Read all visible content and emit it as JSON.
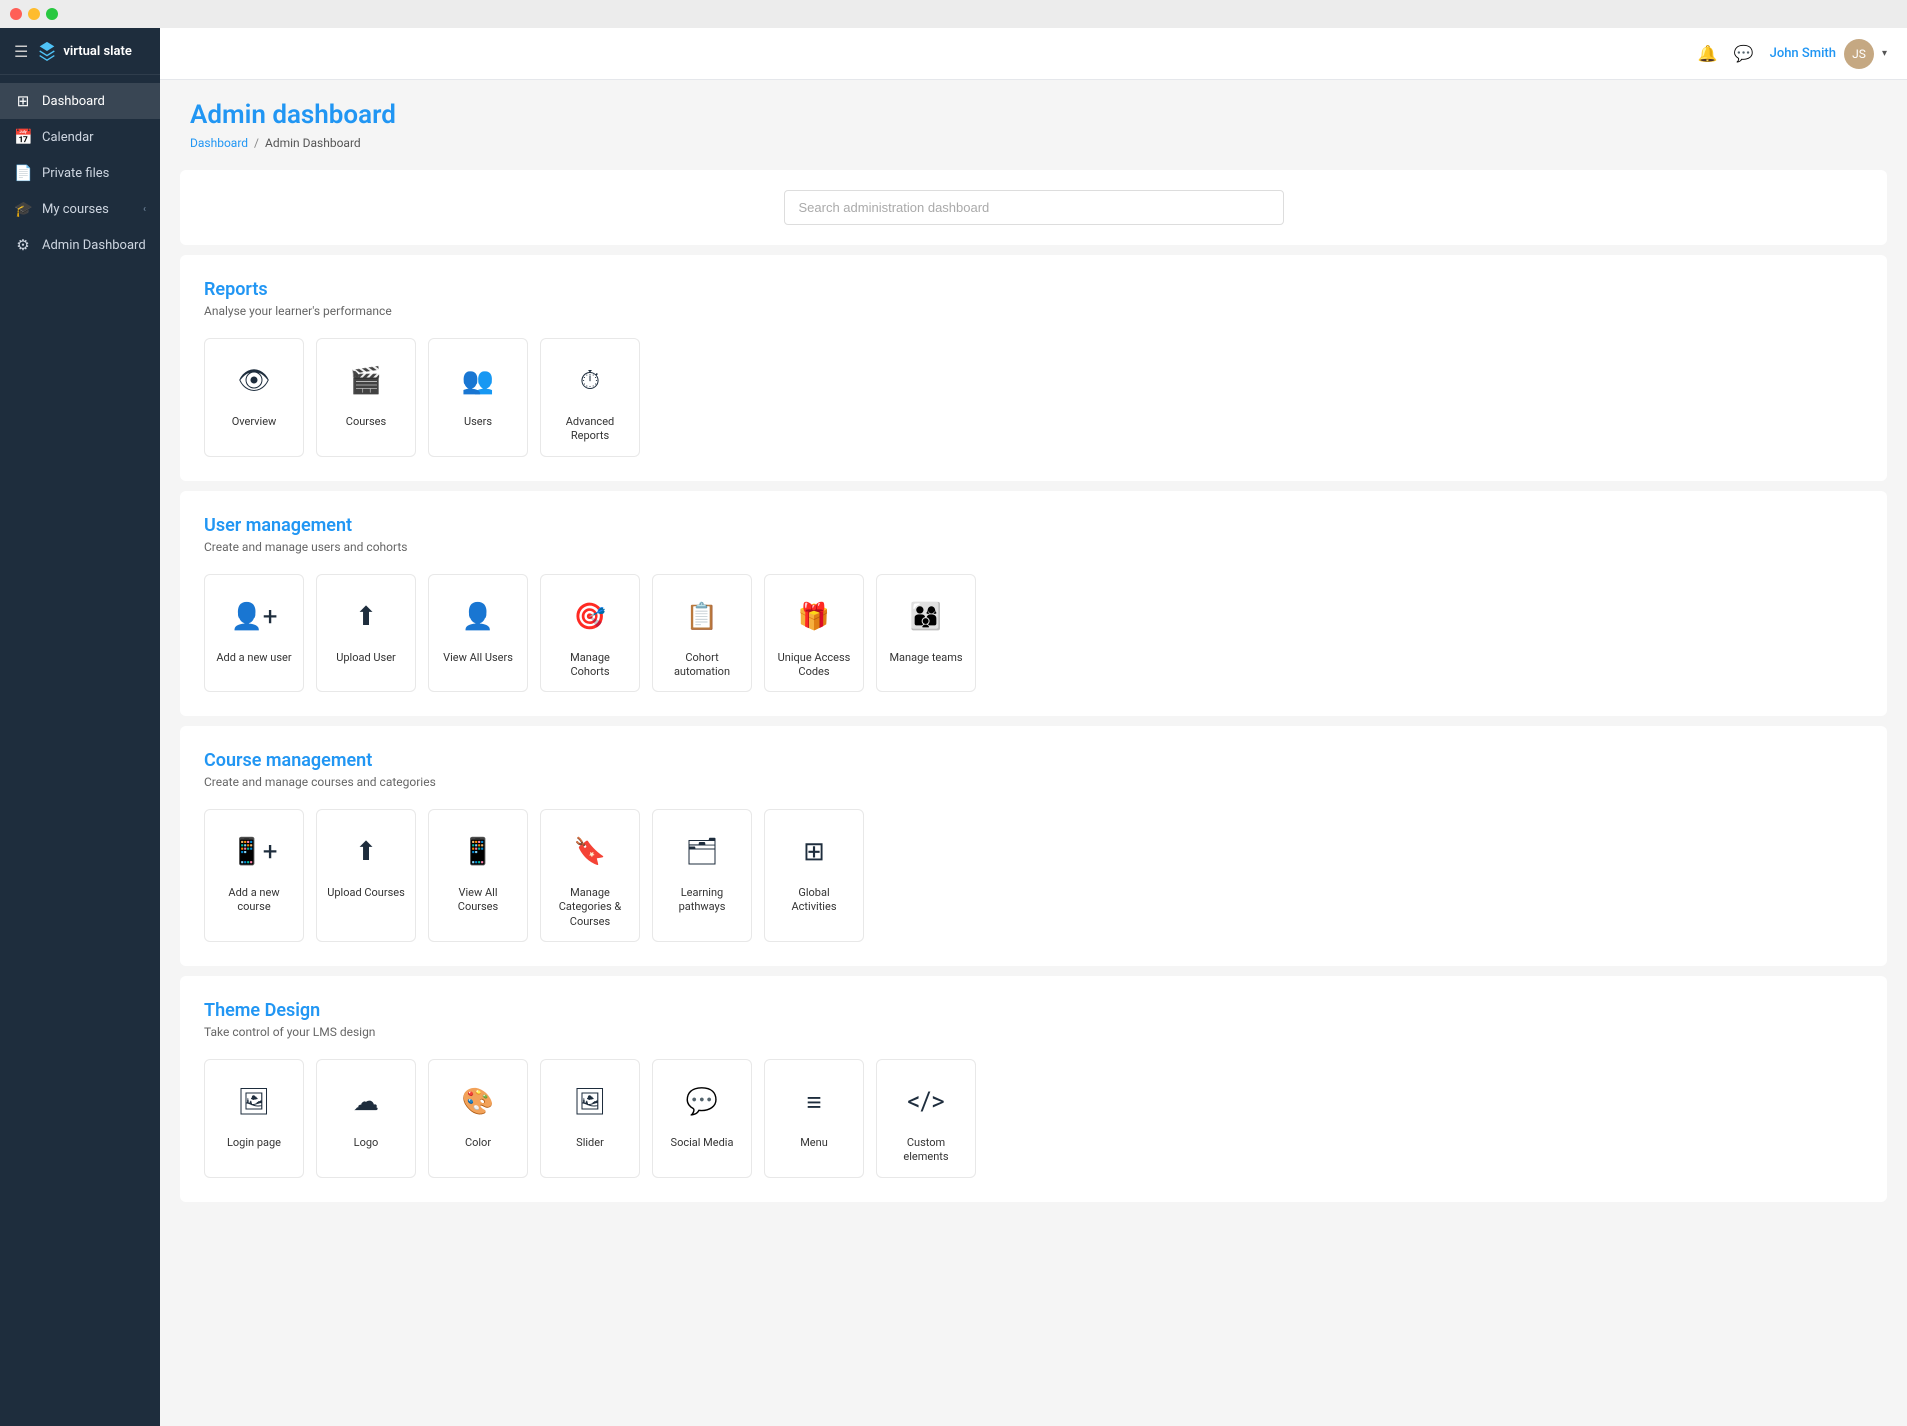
{
  "titlebar": {
    "buttons": [
      "close",
      "minimize",
      "maximize"
    ]
  },
  "brand": {
    "name": "virtual slate",
    "hamburger": "☰"
  },
  "sidebar": {
    "items": [
      {
        "id": "dashboard",
        "label": "Dashboard",
        "icon": "⊞",
        "active": true
      },
      {
        "id": "calendar",
        "label": "Calendar",
        "icon": "📅",
        "active": false
      },
      {
        "id": "private-files",
        "label": "Private files",
        "icon": "📄",
        "active": false
      },
      {
        "id": "my-courses",
        "label": "My courses",
        "icon": "🎓",
        "active": false,
        "hasChevron": true
      },
      {
        "id": "admin-dashboard",
        "label": "Admin Dashboard",
        "icon": "⚙",
        "active": false
      }
    ]
  },
  "topbar": {
    "notification_icon": "🔔",
    "message_icon": "💬",
    "username": "John Smith",
    "chevron": "▾"
  },
  "page": {
    "title": "Admin dashboard",
    "breadcrumb_home": "Dashboard",
    "breadcrumb_sep": "/",
    "breadcrumb_current": "Admin Dashboard"
  },
  "search": {
    "placeholder": "Search administration dashboard"
  },
  "sections": [
    {
      "id": "reports",
      "title": "Reports",
      "description": "Analyse your learner's performance",
      "cards": [
        {
          "id": "overview",
          "label": "Overview",
          "icon": "👁"
        },
        {
          "id": "courses",
          "label": "Courses",
          "icon": "🎬"
        },
        {
          "id": "users",
          "label": "Users",
          "icon": "👥"
        },
        {
          "id": "advanced-reports",
          "label": "Advanced Reports",
          "icon": "⏱"
        }
      ]
    },
    {
      "id": "user-management",
      "title": "User management",
      "description": "Create and manage users and cohorts",
      "cards": [
        {
          "id": "add-new-user",
          "label": "Add a new user",
          "icon": "👤+"
        },
        {
          "id": "upload-user",
          "label": "Upload User",
          "icon": "⬆"
        },
        {
          "id": "view-all-users",
          "label": "View All Users",
          "icon": "👤"
        },
        {
          "id": "manage-cohorts",
          "label": "Manage Cohorts",
          "icon": "🎯"
        },
        {
          "id": "cohort-automation",
          "label": "Cohort automation",
          "icon": "📋"
        },
        {
          "id": "unique-access-codes",
          "label": "Unique Access Codes",
          "icon": "🎁"
        },
        {
          "id": "manage-teams",
          "label": "Manage teams",
          "icon": "👨‍👩‍👦"
        }
      ]
    },
    {
      "id": "course-management",
      "title": "Course management",
      "description": "Create and manage courses and categories",
      "cards": [
        {
          "id": "add-new-course",
          "label": "Add a new course",
          "icon": "📱+"
        },
        {
          "id": "upload-courses",
          "label": "Upload Courses",
          "icon": "⬆"
        },
        {
          "id": "view-all-courses",
          "label": "View All Courses",
          "icon": "📱"
        },
        {
          "id": "manage-categories",
          "label": "Manage Categories & Courses",
          "icon": "🔖"
        },
        {
          "id": "learning-pathways",
          "label": "Learning pathways",
          "icon": "🗂"
        },
        {
          "id": "global-activities",
          "label": "Global Activities",
          "icon": "⊞"
        }
      ]
    },
    {
      "id": "theme-design",
      "title": "Theme Design",
      "description": "Take control of your LMS design",
      "cards": [
        {
          "id": "login-page",
          "label": "Login page",
          "icon": "🖼"
        },
        {
          "id": "logo",
          "label": "Logo",
          "icon": "☁"
        },
        {
          "id": "color",
          "label": "Color",
          "icon": "🎨"
        },
        {
          "id": "slider",
          "label": "Slider",
          "icon": "🖼"
        },
        {
          "id": "social-media",
          "label": "Social Media",
          "icon": "💬"
        },
        {
          "id": "menu",
          "label": "Menu",
          "icon": "≡"
        },
        {
          "id": "custom-elements",
          "label": "Custom elements",
          "icon": "</>"
        }
      ]
    }
  ]
}
